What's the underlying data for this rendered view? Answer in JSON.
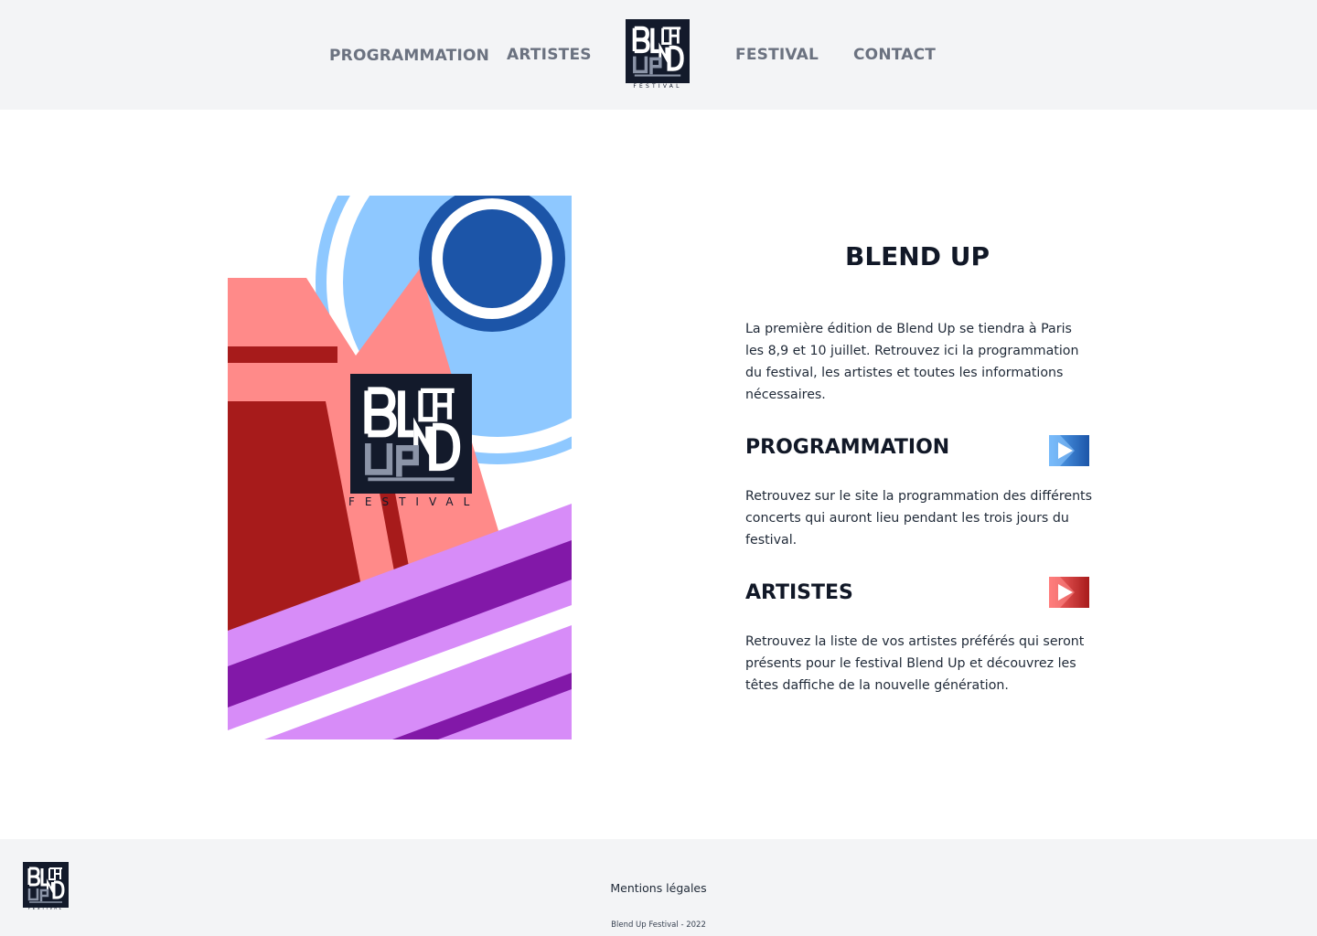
{
  "nav": {
    "programmation": "PROGRAMMATION",
    "artistes": "ARTISTES",
    "festival": "FESTIVAL",
    "contact": "CONTACT"
  },
  "logo": {
    "caption": "FESTIVAL",
    "icon": "blend-up-logo-icon"
  },
  "main": {
    "title": "BLEND UP",
    "intro": "La première édition de Blend Up se tiendra à Paris les 8,9 et 10 juillet. Retrouvez ici la programmation du festival, les artistes et toutes les informations nécessaires.",
    "sections": [
      {
        "title": "PROGRAMMATION",
        "text": "Retrouvez sur le site la programmation des différents concerts qui auront lieu pendant les trois jours du festival.",
        "icon": "play-icon"
      },
      {
        "title": "ARTISTES",
        "text": "Retrouvez la liste de vos artistes préférés qui seront présents pour le festival Blend Up et découvrez les têtes daffiche de la nouvelle génération.",
        "icon": "play-icon"
      }
    ]
  },
  "footer": {
    "legal": "Mentions légales",
    "copyright": "Blend Up Festival - 2022"
  },
  "colors": {
    "header_bg": "#f3f4f6",
    "logo_bg": "#131a2b",
    "light_blue": "#8ec8ff",
    "dark_blue": "#1c55a8",
    "salmon": "#ff8a89",
    "red": "#a71b1b",
    "lilac": "#d78cf8",
    "purple": "#8218a8"
  }
}
